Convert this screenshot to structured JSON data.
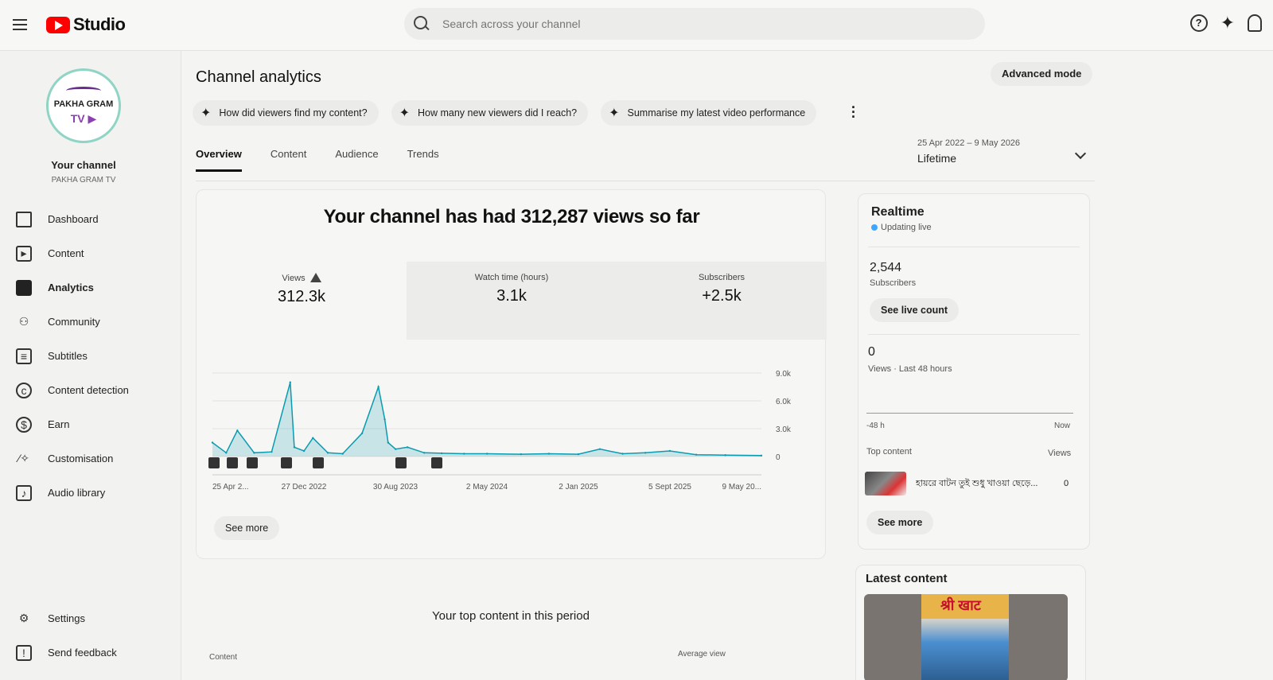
{
  "topbar": {
    "logo_text": "Studio",
    "search_placeholder": "Search across your channel"
  },
  "sidebar": {
    "avatar_line1": "PAKHA GRAM",
    "avatar_line2": "TV",
    "channel_title": "Your channel",
    "channel_name": "PAKHA GRAM TV",
    "items": [
      {
        "label": "Dashboard",
        "icon": "dashboard-icon"
      },
      {
        "label": "Content",
        "icon": "content-icon"
      },
      {
        "label": "Analytics",
        "icon": "analytics-icon"
      },
      {
        "label": "Community",
        "icon": "community-icon"
      },
      {
        "label": "Subtitles",
        "icon": "subtitles-icon"
      },
      {
        "label": "Content detection",
        "icon": "copyright-icon"
      },
      {
        "label": "Earn",
        "icon": "dollar-icon"
      },
      {
        "label": "Customisation",
        "icon": "magic-wand-icon"
      },
      {
        "label": "Audio library",
        "icon": "audio-library-icon"
      }
    ],
    "bottom_items": [
      {
        "label": "Settings",
        "icon": "gear-icon"
      },
      {
        "label": "Send feedback",
        "icon": "feedback-icon"
      }
    ]
  },
  "main": {
    "title": "Channel analytics",
    "advanced_mode": "Advanced mode",
    "chips": [
      "How did viewers find my content?",
      "How many new viewers did I reach?",
      "Summarise my latest video performance"
    ],
    "tabs": [
      "Overview",
      "Content",
      "Audience",
      "Trends"
    ],
    "date_range": "25 Apr 2022 – 9 May 2026",
    "period": "Lifetime",
    "headline": "Your channel has had 312,287 views so far",
    "metrics": [
      {
        "label": "Views",
        "value": "312.3k"
      },
      {
        "label": "Watch time (hours)",
        "value": "3.1k"
      },
      {
        "label": "Subscribers",
        "value": "+2.5k"
      }
    ],
    "see_more": "See more",
    "top_content_title": "Your top content in this period",
    "col_content": "Content",
    "col_avg_view": "Average view"
  },
  "chart_data": {
    "type": "line",
    "ylabel": "Views",
    "yticks": [
      "9.0k",
      "6.0k",
      "3.0k",
      "0"
    ],
    "ylim": [
      0,
      9000
    ],
    "xticks": [
      "25 Apr 2...",
      "27 Dec 2022",
      "30 Aug 2023",
      "2 May 2024",
      "2 Jan 2025",
      "5 Sept 2025",
      "9 May 20..."
    ],
    "x": [
      "2022-04-25",
      "2022-06-01",
      "2022-07-01",
      "2022-08-15",
      "2022-10-01",
      "2022-11-20",
      "2022-12-01",
      "2022-12-27",
      "2023-01-20",
      "2023-03-01",
      "2023-04-10",
      "2023-06-01",
      "2023-07-15",
      "2023-08-01",
      "2023-08-10",
      "2023-08-30",
      "2023-10-01",
      "2023-11-15",
      "2024-01-01",
      "2024-03-01",
      "2024-05-02",
      "2024-08-01",
      "2024-10-15",
      "2025-01-02",
      "2025-03-01",
      "2025-05-01",
      "2025-07-01",
      "2025-09-05",
      "2025-11-15",
      "2026-02-01",
      "2026-05-09"
    ],
    "values": [
      1500,
      400,
      2800,
      400,
      500,
      8000,
      1000,
      600,
      2000,
      400,
      300,
      2500,
      7500,
      4000,
      1500,
      800,
      1000,
      400,
      350,
      300,
      300,
      250,
      300,
      250,
      800,
      300,
      400,
      600,
      200,
      150,
      100
    ]
  },
  "realtime": {
    "title": "Realtime",
    "status": "Updating live",
    "subscribers": "2,544",
    "subscribers_label": "Subscribers",
    "see_live_count": "See live count",
    "views": "0",
    "views_label": "Views · Last 48 hours",
    "axis_start": "-48 h",
    "axis_end": "Now",
    "top_content_label": "Top content",
    "views_col": "Views",
    "top_item_title": "হায়রে বাটন তুই শুধু খাওয়া ছেড়ে...",
    "top_item_views": "0",
    "see_more": "See more"
  },
  "latest": {
    "title": "Latest content",
    "thumb_text": "श्री खाट"
  }
}
